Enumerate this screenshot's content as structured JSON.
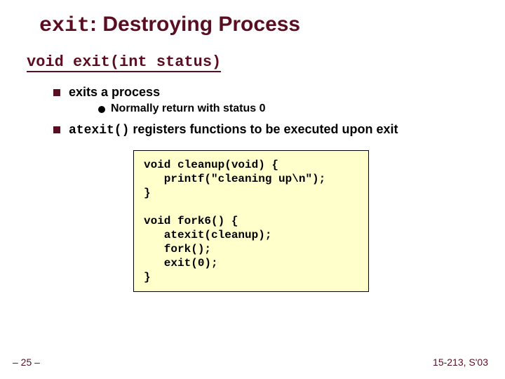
{
  "title": {
    "code": "exit",
    "rest": ": Destroying Process"
  },
  "signature": "void exit(int status)",
  "bullets": {
    "b1": "exits a process",
    "b1_sub": "Normally return with status 0",
    "b2_code": "atexit()",
    "b2_rest": " registers functions to be executed upon exit"
  },
  "code": "void cleanup(void) {\n   printf(\"cleaning up\\n\");\n}\n\nvoid fork6() {\n   atexit(cleanup);\n   fork();\n   exit(0);\n}",
  "footer": {
    "page": "– 25 –",
    "course": "15-213, S'03"
  }
}
